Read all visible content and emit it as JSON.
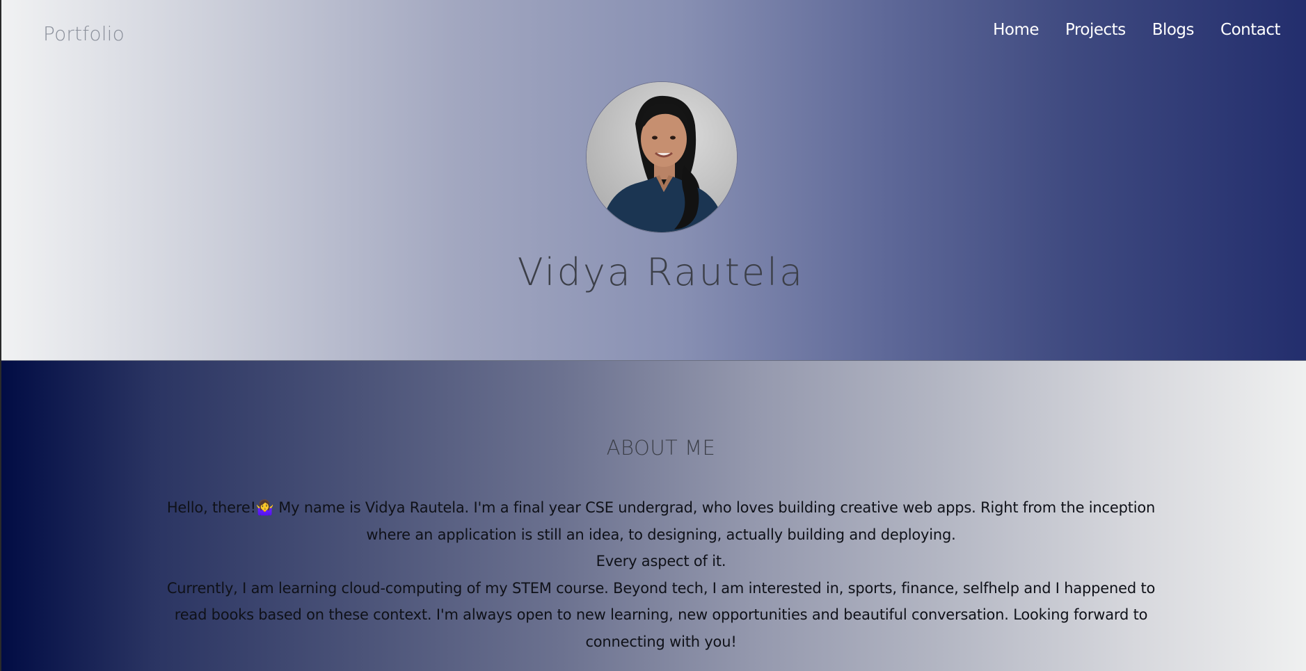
{
  "header": {
    "brand": "Portfolio",
    "nav": [
      {
        "label": "Home"
      },
      {
        "label": "Projects"
      },
      {
        "label": "Blogs"
      },
      {
        "label": "Contact"
      }
    ]
  },
  "hero": {
    "name": "Vidya Rautela",
    "avatar_icon": "profile-photo"
  },
  "about": {
    "title": "ABOUT ME",
    "intro_before_emoji": "Hello, there!",
    "emoji": "🤷‍♀️",
    "intro_after_emoji": " My name is Vidya Rautela. I'm a final year CSE undergrad, who loves building creative web apps. Right from the inception where an application is still an idea, to designing, actually building and deploying.",
    "line2": "Every aspect of it.",
    "line3": "Currently, I am learning cloud-computing of my STEM course. Beyond tech, I am interested in, sports, finance, selfhelp and I happened to read books based on these context. I'm always open to new learning, new opportunities and beautiful conversation. Looking forward to connecting with you!"
  },
  "colors": {
    "hero_gradient_start": "#f1f2f3",
    "hero_gradient_end": "#232e6d",
    "about_gradient_start": "#010c44",
    "about_gradient_end": "#eff0f0",
    "nav_text": "#ffffff",
    "heading_text": "#3c3f48"
  }
}
